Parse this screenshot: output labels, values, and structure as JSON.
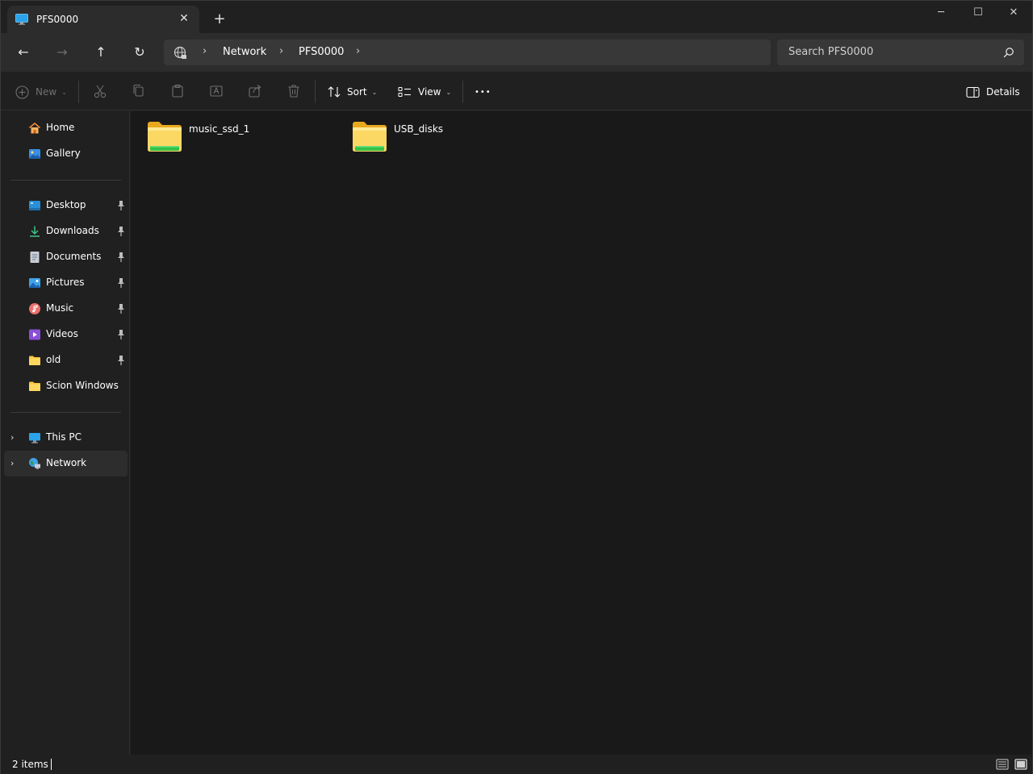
{
  "window": {
    "tab_title": "PFS0000",
    "close_tab_glyph": "✕",
    "new_tab_glyph": "+",
    "minimize_glyph": "─",
    "maximize_glyph": "☐",
    "close_glyph": "✕"
  },
  "nav": {
    "back_glyph": "←",
    "forward_glyph": "→",
    "up_glyph": "↑",
    "refresh_glyph": "↻"
  },
  "breadcrumb": {
    "items": [
      "Network",
      "PFS0000"
    ],
    "separator": "›"
  },
  "search": {
    "placeholder": "Search PFS0000"
  },
  "toolbar": {
    "new_label": "New",
    "sort_label": "Sort",
    "view_label": "View",
    "more_glyph": "•••",
    "details_label": "Details",
    "dropdown_glyph": "⌄"
  },
  "sidebar": {
    "top": [
      {
        "label": "Home",
        "icon": "home-icon"
      },
      {
        "label": "Gallery",
        "icon": "gallery-icon"
      }
    ],
    "quick_access": [
      {
        "label": "Desktop",
        "icon": "desktop-icon",
        "pinned": true
      },
      {
        "label": "Downloads",
        "icon": "downloads-icon",
        "pinned": true
      },
      {
        "label": "Documents",
        "icon": "documents-icon",
        "pinned": true
      },
      {
        "label": "Pictures",
        "icon": "pictures-icon",
        "pinned": true
      },
      {
        "label": "Music",
        "icon": "music-icon",
        "pinned": true
      },
      {
        "label": "Videos",
        "icon": "videos-icon",
        "pinned": true
      },
      {
        "label": "old",
        "icon": "folder-icon",
        "pinned": true
      },
      {
        "label": "Scion Windows",
        "icon": "folder-icon",
        "pinned": false
      }
    ],
    "locations": [
      {
        "label": "This PC",
        "icon": "this-pc-icon",
        "selected": false
      },
      {
        "label": "Network",
        "icon": "network-icon",
        "selected": true
      }
    ],
    "expand_glyph": "›"
  },
  "content": {
    "items": [
      {
        "name": "music_ssd_1",
        "icon": "network-share-folder-icon"
      },
      {
        "name": "USB_disks",
        "icon": "network-share-folder-icon"
      }
    ]
  },
  "status": {
    "count": "2 items"
  },
  "colors": {
    "folder_yellow": "#f8c73c",
    "folder_light": "#fde18a",
    "share_green": "#35c24a",
    "accent_blue": "#4cc2ff"
  }
}
